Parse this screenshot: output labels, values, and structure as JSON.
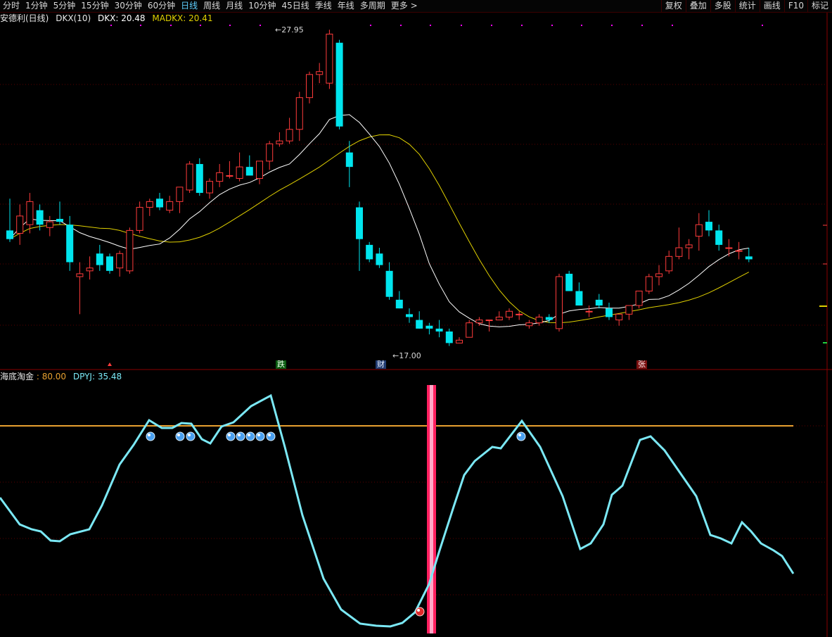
{
  "toolbar": {
    "items": [
      "分时",
      "1分钟",
      "5分钟",
      "15分钟",
      "30分钟",
      "60分钟",
      "日线",
      "周线",
      "月线",
      "10分钟",
      "45日线",
      "季线",
      "年线",
      "多周期",
      "更多 >"
    ],
    "active_index": 6,
    "right_items": [
      "复权",
      "叠加",
      "多股",
      "统计",
      "画线",
      "F10",
      "标记"
    ]
  },
  "main_panel": {
    "stock_name": "安德利(日线)",
    "indicator": "DKX(10)",
    "dkx_label": "DKX: 20.48",
    "madkx_label": "MADKX: 20.41",
    "high_label": "27.95",
    "low_label": "17.00",
    "tags": [
      "跌",
      "财",
      "张"
    ],
    "colors": {
      "up": "#ff3b3b",
      "down": "#00e5ee",
      "dkx": "#ffffff",
      "madkx": "#e0d000",
      "magenta": "#ff00ff"
    }
  },
  "sub_panel": {
    "name": "海底淘金",
    "level_label": ": 80.00",
    "dpyj_label": "DPYJ: 35.48",
    "colors": {
      "line": "#7be8f5",
      "level": "#e8a030",
      "bar": "#ff2060"
    }
  },
  "chart_data": {
    "type": "candlestick",
    "price_range": [
      16.5,
      28.2
    ],
    "candles": [
      [
        21.0,
        22.1,
        20.6,
        20.7
      ],
      [
        20.9,
        21.9,
        20.5,
        21.5
      ],
      [
        21.2,
        22.3,
        20.9,
        22.0
      ],
      [
        21.7,
        21.9,
        21.0,
        21.2
      ],
      [
        21.1,
        21.5,
        20.8,
        21.3
      ],
      [
        21.4,
        22.0,
        21.2,
        21.3
      ],
      [
        21.2,
        21.5,
        19.6,
        19.9
      ],
      [
        19.4,
        19.9,
        18.1,
        19.5
      ],
      [
        19.6,
        20.1,
        19.3,
        19.7
      ],
      [
        20.2,
        20.5,
        19.6,
        19.8
      ],
      [
        20.1,
        20.2,
        19.5,
        19.6
      ],
      [
        19.7,
        20.3,
        19.4,
        20.2
      ],
      [
        19.6,
        21.1,
        19.5,
        21.0
      ],
      [
        21.0,
        22.0,
        20.9,
        21.8
      ],
      [
        21.8,
        22.1,
        21.5,
        22.0
      ],
      [
        22.1,
        22.3,
        21.7,
        21.8
      ],
      [
        21.7,
        22.2,
        21.6,
        22.0
      ],
      [
        22.0,
        22.3,
        21.6,
        22.5
      ],
      [
        22.4,
        23.4,
        22.3,
        23.3
      ],
      [
        23.3,
        23.5,
        22.2,
        22.3
      ],
      [
        22.3,
        22.8,
        22.1,
        22.7
      ],
      [
        22.7,
        23.3,
        22.5,
        23.0
      ],
      [
        22.9,
        23.4,
        22.8,
        22.9
      ],
      [
        22.8,
        23.7,
        22.7,
        23.2
      ],
      [
        23.2,
        23.6,
        23.0,
        22.9
      ],
      [
        22.8,
        23.4,
        22.6,
        23.4
      ],
      [
        23.4,
        24.1,
        23.1,
        24.0
      ],
      [
        24.0,
        24.4,
        23.9,
        24.1
      ],
      [
        24.1,
        24.9,
        24.0,
        24.5
      ],
      [
        24.5,
        25.8,
        24.1,
        25.6
      ],
      [
        25.6,
        26.5,
        25.4,
        26.4
      ],
      [
        26.4,
        26.8,
        26.1,
        26.5
      ],
      [
        26.1,
        27.95,
        25.9,
        27.8
      ],
      [
        27.5,
        27.6,
        24.5,
        24.6
      ],
      [
        23.7,
        24.1,
        22.5,
        23.2
      ],
      [
        21.8,
        22.0,
        19.6,
        20.7
      ],
      [
        20.5,
        20.6,
        19.9,
        20.0
      ],
      [
        20.2,
        20.4,
        19.7,
        19.8
      ],
      [
        19.6,
        19.9,
        18.6,
        18.7
      ],
      [
        18.6,
        18.9,
        18.3,
        18.3
      ],
      [
        18.1,
        18.3,
        17.8,
        18.0
      ],
      [
        17.9,
        18.2,
        17.6,
        17.6
      ],
      [
        17.7,
        17.8,
        17.4,
        17.6
      ],
      [
        17.6,
        17.9,
        17.3,
        17.5
      ],
      [
        17.5,
        17.6,
        17.0,
        17.1
      ],
      [
        17.1,
        17.3,
        17.1,
        17.2
      ],
      [
        17.3,
        17.9,
        17.3,
        17.8
      ],
      [
        17.8,
        18.0,
        17.7,
        17.9
      ],
      [
        17.9,
        17.9,
        17.5,
        17.9
      ],
      [
        17.9,
        18.2,
        17.9,
        18.0
      ],
      [
        18.0,
        18.3,
        17.9,
        18.2
      ],
      [
        18.1,
        18.2,
        17.9,
        18.1
      ],
      [
        17.7,
        17.9,
        17.6,
        17.8
      ],
      [
        17.8,
        18.1,
        17.7,
        18.0
      ],
      [
        18.0,
        18.1,
        17.8,
        17.9
      ],
      [
        17.6,
        19.5,
        17.5,
        19.4
      ],
      [
        19.5,
        19.6,
        18.9,
        18.9
      ],
      [
        18.9,
        19.2,
        18.4,
        18.4
      ],
      [
        18.2,
        18.4,
        18.0,
        18.2
      ],
      [
        18.6,
        18.8,
        18.3,
        18.4
      ],
      [
        18.3,
        18.5,
        17.9,
        18.0
      ],
      [
        17.9,
        18.1,
        17.7,
        18.1
      ],
      [
        18.1,
        18.3,
        17.9,
        18.4
      ],
      [
        18.4,
        18.9,
        18.3,
        18.9
      ],
      [
        18.9,
        19.5,
        18.8,
        19.4
      ],
      [
        19.4,
        19.8,
        19.1,
        19.5
      ],
      [
        19.6,
        20.3,
        19.5,
        20.1
      ],
      [
        20.1,
        21.1,
        20.0,
        20.4
      ],
      [
        20.4,
        20.7,
        20.0,
        20.5
      ],
      [
        20.8,
        21.6,
        20.3,
        21.2
      ],
      [
        21.3,
        21.7,
        20.8,
        21.0
      ],
      [
        21.0,
        21.2,
        20.3,
        20.5
      ],
      [
        20.4,
        20.7,
        20.1,
        20.4
      ],
      [
        20.3,
        20.6,
        20.0,
        20.3
      ],
      [
        20.1,
        20.4,
        19.9,
        20.0
      ]
    ]
  }
}
